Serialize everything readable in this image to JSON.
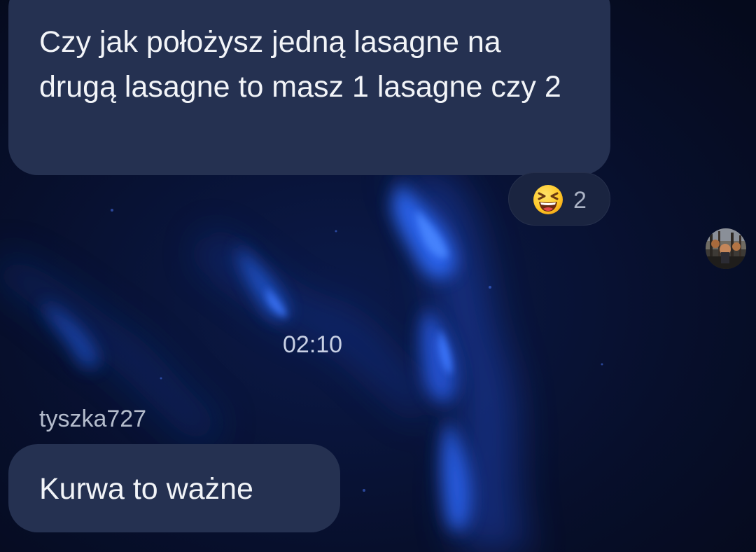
{
  "messages": [
    {
      "text": "Czy jak położysz jedną lasagne na drugą lasagne to masz 1 lasagne czy 2",
      "reaction": {
        "emoji_icon": "laughing-face-icon",
        "count": "2"
      }
    },
    {
      "sender": "tyszka727",
      "text": "Kurwa to ważne"
    }
  ],
  "timestamp": "02:10",
  "colors": {
    "background": "#070d24",
    "bubble": "#253151",
    "reaction_pill": "#1a2440",
    "text": "#f2f4f8",
    "muted_text": "#b4bccc"
  }
}
